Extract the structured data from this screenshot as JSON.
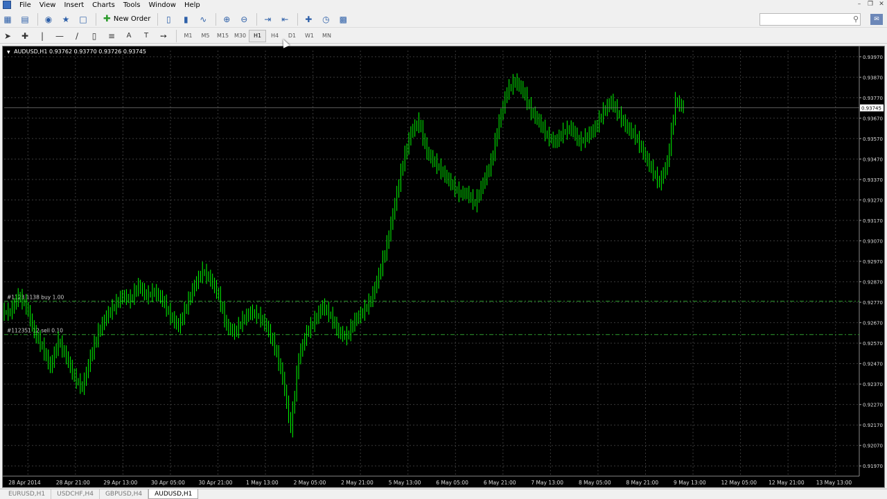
{
  "menu": {
    "items": [
      {
        "label": "File"
      },
      {
        "label": "View"
      },
      {
        "label": "Insert"
      },
      {
        "label": "Charts"
      },
      {
        "label": "Tools"
      },
      {
        "label": "Window"
      },
      {
        "label": "Help"
      }
    ]
  },
  "toolbar": {
    "new_order_label": "New Order",
    "timeframes": [
      "M1",
      "M5",
      "M15",
      "M30",
      "H1",
      "H4",
      "D1",
      "W1",
      "MN"
    ],
    "active_timeframe": "H1",
    "search_placeholder": ""
  },
  "chart": {
    "header": "AUDUSD,H1  0.93762 0.93770 0.93726 0.93745",
    "background": "#000000",
    "candle_color": "#00ff00",
    "grid_color": "#3a3a3a",
    "current_price_label": "0.93745",
    "orders": [
      {
        "label": "#1123 1138 buy 1.00",
        "price": 0.92775
      },
      {
        "label": "#112351 12 sell 0.10",
        "price": 0.92612
      }
    ],
    "price_labels": [
      "0.93970",
      "0.93870",
      "0.93770",
      "0.93670",
      "0.93570",
      "0.93470",
      "0.93370",
      "0.93270",
      "0.93170",
      "0.93070",
      "0.92970",
      "0.92870",
      "0.92770",
      "0.92670",
      "0.92570",
      "0.92470",
      "0.92370",
      "0.92270",
      "0.92170",
      "0.92070",
      "0.91970"
    ],
    "time_labels": [
      "28 Apr 2014",
      "28 Apr 21:00",
      "29 Apr 13:00",
      "30 Apr 05:00",
      "30 Apr 21:00",
      "1 May 13:00",
      "2 May 05:00",
      "2 May 21:00",
      "5 May 13:00",
      "6 May 05:00",
      "6 May 21:00",
      "7 May 13:00",
      "8 May 05:00",
      "8 May 21:00",
      "9 May 13:00",
      "12 May 05:00",
      "12 May 21:00",
      "13 May 13:00"
    ]
  },
  "chart_data": {
    "type": "line",
    "title": "AUDUSD,H1",
    "xlabel": "",
    "ylabel": "",
    "ylim": [
      0.9192,
      0.94
    ],
    "series": [
      {
        "values": [
          0.9272,
          0.928,
          0.9275,
          0.9262,
          0.9255,
          0.9245,
          0.9258,
          0.925,
          0.924,
          0.9235,
          0.925,
          0.9262,
          0.927,
          0.9275,
          0.928,
          0.9278,
          0.9285,
          0.928,
          0.9282,
          0.9278,
          0.927,
          0.9265,
          0.9275,
          0.9285,
          0.9292,
          0.9288,
          0.928,
          0.9265,
          0.9262,
          0.9268,
          0.9272,
          0.927,
          0.9265,
          0.9255,
          0.924,
          0.9215,
          0.925,
          0.9262,
          0.9268,
          0.9275,
          0.927,
          0.9262,
          0.926,
          0.9268,
          0.9272,
          0.9278,
          0.929,
          0.9305,
          0.9325,
          0.9345,
          0.936,
          0.9365,
          0.935,
          0.9345,
          0.934,
          0.9335,
          0.933,
          0.933,
          0.9325,
          0.9335,
          0.9345,
          0.9365,
          0.938,
          0.9385,
          0.938,
          0.937,
          0.9365,
          0.9358,
          0.9355,
          0.936,
          0.9362,
          0.9355,
          0.9358,
          0.9362,
          0.937,
          0.9375,
          0.9368,
          0.9362,
          0.9358,
          0.935,
          0.9342,
          0.9335,
          0.9345,
          0.9375,
          0.9372
        ]
      }
    ]
  },
  "tabs": [
    {
      "label": "EURUSD,H1"
    },
    {
      "label": "USDCHF,H4"
    },
    {
      "label": "GBPUSD,H4"
    },
    {
      "label": "AUDUSD,H1"
    }
  ]
}
